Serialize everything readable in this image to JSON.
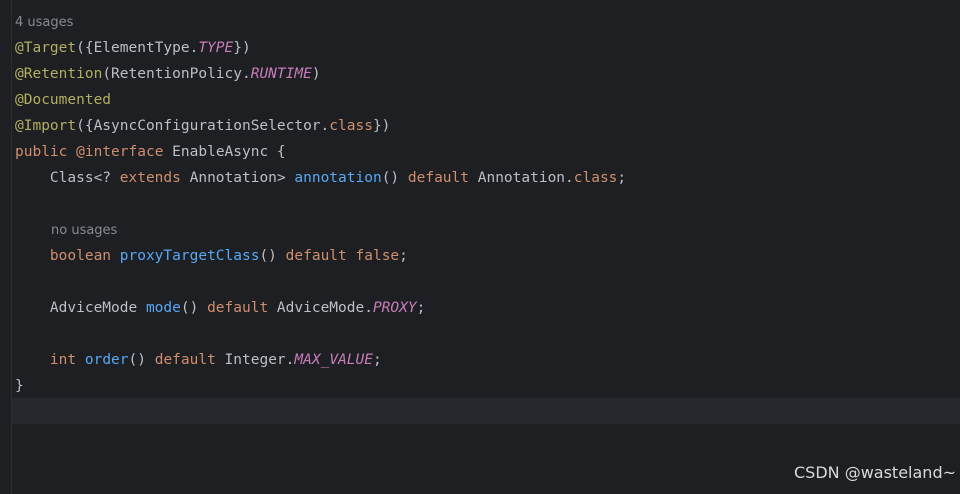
{
  "hints": {
    "usages_top": "4 usages",
    "usages_proxy": "no usages"
  },
  "code": {
    "l1": {
      "ann": "@Target",
      "p1": "({ElementType.",
      "c1": "TYPE",
      "p2": "})"
    },
    "l2": {
      "ann": "@Retention",
      "p1": "(RetentionPolicy.",
      "c1": "RUNTIME",
      "p2": ")"
    },
    "l3": {
      "ann": "@Documented"
    },
    "l4": {
      "ann": "@Import",
      "p1": "({AsyncConfigurationSelector.",
      "k1": "class",
      "p2": "})"
    },
    "l5": {
      "k1": "public",
      "sp1": " ",
      "k2": "@interface",
      "p1": " EnableAsync {"
    },
    "l6": {
      "indent": "    ",
      "p1": "Class<? ",
      "k1": "extends",
      "p2": " Annotation> ",
      "f1": "annotation",
      "p3": "() ",
      "k2": "default",
      "p4": " Annotation.",
      "k3": "class",
      "p5": ";"
    },
    "l7": {
      "indent": "    ",
      "k1": "boolean",
      "sp1": " ",
      "f1": "proxyTargetClass",
      "p1": "() ",
      "k2": "default",
      "sp2": " ",
      "k3": "false",
      "p2": ";"
    },
    "l8": {
      "indent": "    ",
      "p1": "AdviceMode ",
      "f1": "mode",
      "p2": "() ",
      "k1": "default",
      "p3": " AdviceMode.",
      "c1": "PROXY",
      "p4": ";"
    },
    "l9": {
      "indent": "    ",
      "k1": "int",
      "sp1": " ",
      "f1": "order",
      "p1": "() ",
      "k2": "default",
      "p2": " Integer.",
      "c1": "MAX_VALUE",
      "p3": ";"
    },
    "l10": {
      "p1": "}"
    }
  },
  "watermark": "CSDN @wasteland~",
  "colors": {
    "background": "#1e1f22",
    "annotation": "#b3ae60",
    "keyword": "#cf8e6d",
    "method": "#56a8f5",
    "constant": "#c77dbb",
    "text": "#bcbec4",
    "hint": "#868a91"
  }
}
